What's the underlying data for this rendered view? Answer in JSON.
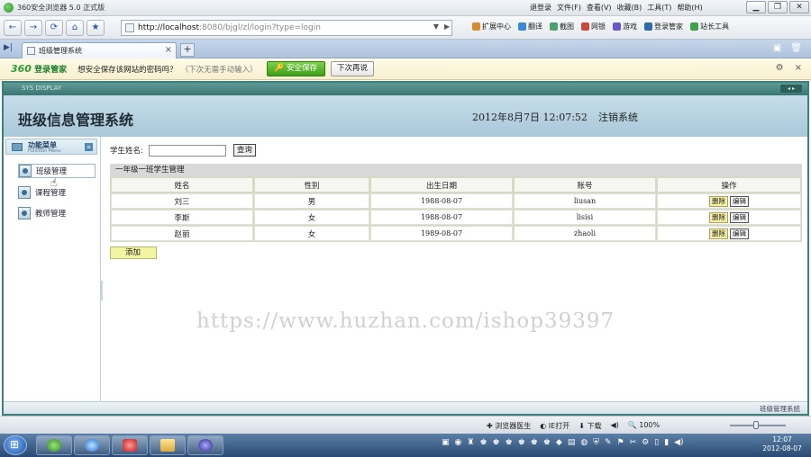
{
  "browser": {
    "title": "360安全浏览器 5.0 正式版",
    "menu": [
      "退登录",
      "文件(F)",
      "查看(V)",
      "收藏(B)",
      "工具(T)",
      "帮助(H)"
    ],
    "window_buttons": [
      "▁",
      "❐",
      "✕"
    ],
    "nav_buttons": [
      "←",
      "→",
      "⟳",
      "⌂",
      "★"
    ],
    "url_host": "http://localhost",
    "url_rest": ":8080/bjgl/zl/login?type=login",
    "toolbar": [
      "扩展中心",
      "翻译",
      "截图",
      "网银",
      "游戏",
      "登录管家",
      "站长工具"
    ],
    "tab": {
      "label": "班级管理系统",
      "close": "×"
    },
    "newtab": "+",
    "tab_tools": [
      "▣",
      "🗑"
    ]
  },
  "password_bar": {
    "brand_num": "360",
    "brand_text": "登录管家",
    "question": "想安全保存该网站的密码吗？",
    "hint": "（下次无需手动输入）",
    "save_label": "安全保存",
    "later_label": "下次再说",
    "gear": "⚙",
    "close": "×"
  },
  "app": {
    "strip_label": "SYS DISPLAY",
    "strip_btns": "◂ ▸",
    "title": "班级信息管理系统",
    "datetime": "2012年8月7日  12:07:52",
    "logout": "注销系统",
    "sidebar": {
      "head": "功能菜单",
      "head_sub": "Function Menu",
      "collapse": "≡",
      "items": [
        "班级管理",
        "课程管理",
        "教师管理"
      ]
    },
    "search": {
      "label": "学生姓名:",
      "button": "查询"
    },
    "grid": {
      "caption": "一年级一班学生管理",
      "headers": [
        "姓名",
        "性别",
        "出生日期",
        "账号",
        "操作"
      ],
      "rows": [
        {
          "name": "刘三",
          "gender": "男",
          "birth": "1988-08-07",
          "account": "liusan"
        },
        {
          "name": "李斯",
          "gender": "女",
          "birth": "1988-08-07",
          "account": "lisisi"
        },
        {
          "name": "赵丽",
          "gender": "女",
          "birth": "1989-08-07",
          "account": "zhaoli"
        }
      ],
      "delete_label": "删除",
      "edit_label": "编辑"
    },
    "add_label": "添加",
    "footer": "班级管理系统"
  },
  "statusbar": [
    "浏览器医生",
    "IE打开",
    "下载",
    "100%"
  ],
  "taskbar": {
    "clock_time": "12:07",
    "clock_date": "2012-08-07"
  },
  "watermark": "https://www.huzhan.com/ishop39397"
}
